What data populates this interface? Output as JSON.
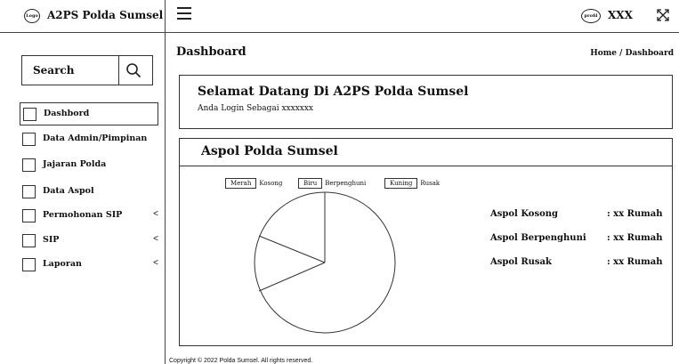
{
  "brand": {
    "logo_text": "Logo",
    "title": "A2PS Polda Sumsel"
  },
  "search": {
    "label": "Search"
  },
  "sidebar": {
    "items": [
      {
        "label": "Dashbord",
        "chevron": ""
      },
      {
        "label": "Data Admin/Pimpinan",
        "chevron": ""
      },
      {
        "label": "Jajaran Polda",
        "chevron": ""
      },
      {
        "label": "Data Aspol",
        "chevron": ""
      },
      {
        "label": "Permohonan SIP",
        "chevron": "<"
      },
      {
        "label": "SIP",
        "chevron": "<"
      },
      {
        "label": "Laporan",
        "chevron": "<"
      }
    ]
  },
  "topbar": {
    "profile_avatar": "profil",
    "profile_name": "XXX"
  },
  "page": {
    "title": "Dashboard",
    "breadcrumb": "Home  /  Dashboard"
  },
  "welcome": {
    "title": "Selamat Datang Di A2PS Polda Sumsel",
    "subtitle": "Anda Login Sebagai xxxxxxx"
  },
  "aspol": {
    "title": "Aspol Polda Sumsel",
    "legend": [
      {
        "box": "Merah",
        "label": "Kosong"
      },
      {
        "box": "Biru",
        "label": "Berpenghuni"
      },
      {
        "box": "Kuning",
        "label": "Rusak"
      }
    ],
    "stats": [
      {
        "name": "Aspol Kosong",
        "value": ": xx Rumah"
      },
      {
        "name": "Aspol Berpenghuni",
        "value": ": xx Rumah"
      },
      {
        "name": "Aspol Rusak",
        "value": ": xx Rumah"
      }
    ]
  },
  "footer": {
    "text": "Copyright © 2022 Polda Sumsel. All rights reserved."
  }
}
